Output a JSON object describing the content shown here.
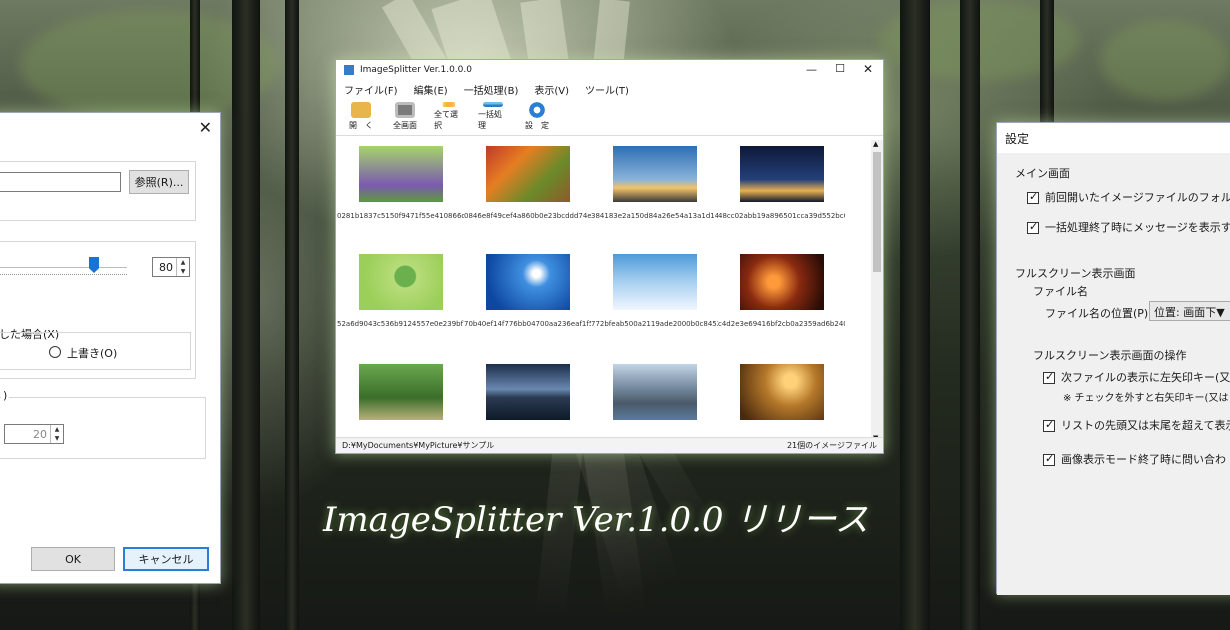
{
  "left_dialog": {
    "browse_label": "参照(R)...",
    "slider_value": "80",
    "option_label": "した場合(X)",
    "radio_label": "上書き(O)",
    "group_label": ")",
    "spin_value": "20",
    "ok_label": "OK",
    "cancel_label": "キャンセル",
    "slider_position_fraction": 0.8
  },
  "main_window": {
    "title": "ImageSplitter Ver.1.0.0.0",
    "menu": [
      "ファイル(F)",
      "編集(E)",
      "一括処理(B)",
      "表示(V)",
      "ツール(T)"
    ],
    "toolbar": [
      {
        "label": "開　く",
        "icon": "folder-open-icon"
      },
      {
        "label": "全画面",
        "icon": "fullscreen-icon"
      },
      {
        "label": "全て選択",
        "icon": "select-all-icon"
      },
      {
        "label": "一括処理",
        "icon": "batch-process-icon"
      },
      {
        "label": "設　定",
        "icon": "settings-gear-icon"
      }
    ],
    "thumbnails": [
      {
        "caption": "0281b1837c5150f9471f55e410866d7...",
        "color": "#7cba5a"
      },
      {
        "caption": "0846e8f49cef4a860b0e23bcddd74ea...",
        "color": "#a4582a"
      },
      {
        "caption": "384183e2a150d84a26e54a13a1d1400...",
        "color": "#4d89c7"
      },
      {
        "caption": "48cc02abb19a896501cca39d552bc0b...",
        "color": "#1f2d5a"
      },
      {
        "caption": "52a6d9043c536b9124557e0e239bf79...",
        "color": "#8bc34a"
      },
      {
        "caption": "70b40ef14f776bb04700aa236eaf1f5...",
        "color": "#1565c0"
      },
      {
        "caption": "772bfeab500a2119ade2000b0c84520...",
        "color": "#5da7e0"
      },
      {
        "caption": "c4d2e3e69416bf2cb0a2359ad6b240e...",
        "color": "#6b2a12"
      },
      {
        "caption": "",
        "color": "#4e8a3a"
      },
      {
        "caption": "",
        "color": "#3d5a7a"
      },
      {
        "caption": "",
        "color": "#6a8aa5"
      },
      {
        "caption": "",
        "color": "#a67a2a"
      }
    ],
    "status_path": "D:¥MyDocuments¥MyPicture¥サンプル",
    "status_count": "21個のイメージファイル"
  },
  "settings": {
    "title": "設定",
    "main_screen": "メイン画面",
    "opt1": "前回開いたイメージファイルのフォルダをデ",
    "opt2": "一括処理終了時にメッセージを表示する",
    "fullscreen": "フルスクリーン表示画面",
    "filename": "ファイル名",
    "filename_pos_label": "ファイル名の位置(P)",
    "filename_pos_value": "位置: 画面下▼",
    "operation": "フルスクリーン表示画面の操作",
    "op1": "次ファイルの表示に左矢印キー(又は",
    "op1_note": "※ チェックを外すと右矢印キー(又は",
    "op2": "リストの先頭又は末尾を超えて表示",
    "op3": "画像表示モード終了時に問い合わ"
  },
  "release_text": "ImageSplitter Ver.1.0.0 リリース"
}
